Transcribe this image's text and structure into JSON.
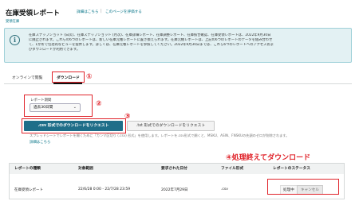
{
  "header": {
    "title": "在庫受領レポート",
    "links": [
      "詳細はこちら",
      "このページを評価する"
    ],
    "separator": "|",
    "breadcrumb": "受領在庫"
  },
  "info": {
    "icon": "info-icon",
    "lines": [
      "在庫スナップショット (日次)、在庫スナップショット (月次)、在庫詳細レポート、在庫調整レポート、在庫照合確認、在庫受領レポートは、2022年9月30日",
      "に廃止されます。これらの6つのレポートは、新しい在庫元帳レポートに置き換えられます。在庫元帳レポートは、上記の6つのレポートのデータを組み合わせ",
      "て、1か所で包括的なビューを提供します。詳しくは、在庫元帳レポートを参照してください。2022年9月30日までは、これら6つのレポートへのアクセスおよ",
      "びダウンロードが利用できます。"
    ]
  },
  "tabs": [
    {
      "label": "オンラインで閲覧",
      "active": false
    },
    {
      "label": "ダウンロード",
      "active": true
    }
  ],
  "annotations": {
    "c1": "①",
    "c2": "②",
    "c3": "③",
    "c4": "④処理終えてダウンロード",
    "color": "#e0242b"
  },
  "form": {
    "period_label": "レポート期間",
    "period_value": "過去30日間",
    "primary_button": ".csv 形式でのダウンロードをリクエスト",
    "secondary_button": ".txt 形式でのダウンロードをリクエスト",
    "hint": "スプレッドシートでレポートを開くために「カンマ区切り (.csv) 形式」を使用します。レポートを.csv形式で開くと、MSKU、ASIN、FNSKUの先頭のゼロが削除されます。",
    "hint_link": "詳細はこちら"
  },
  "table": {
    "headers": [
      "レポートの種類",
      "対象範囲",
      "要求された日付",
      "ファイル形式",
      "レポートのステータス"
    ],
    "row": {
      "type": "在庫受領レポート",
      "range": "22/6/28 0:00 - 22/7/28 23:59",
      "requested": "2022年7月29日",
      "format": ".csv",
      "status": "処理中",
      "cancel": "キャンセル"
    }
  },
  "colors": {
    "accent": "#007185",
    "primary_button": "#1f6e89",
    "info_bg": "#e3f1f3"
  }
}
